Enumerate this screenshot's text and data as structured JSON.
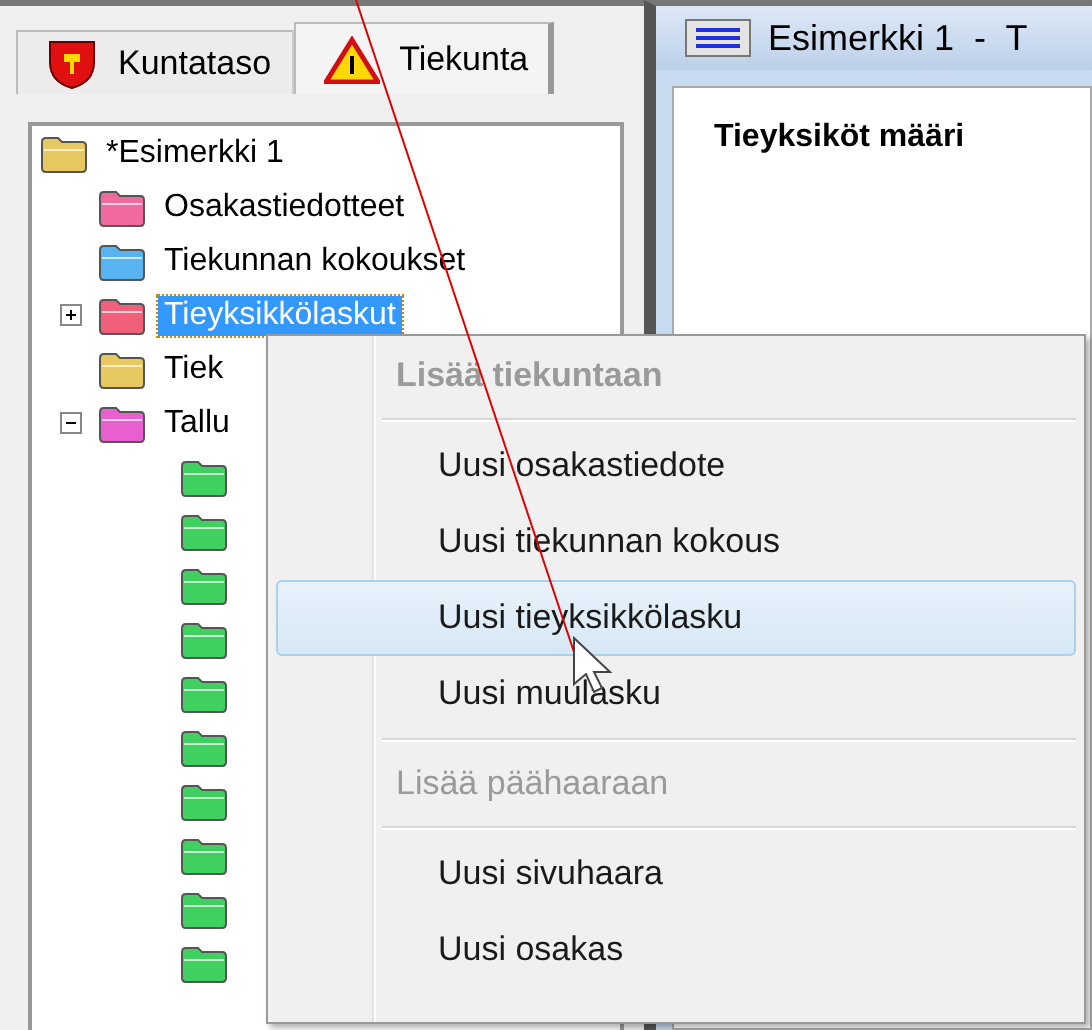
{
  "left_tabs": [
    {
      "label": "Kuntataso",
      "selected": false
    },
    {
      "label": "Tiekunta",
      "selected": true
    }
  ],
  "tree": {
    "label": "*Esimerkki 1",
    "color": "#e8c860",
    "children": [
      {
        "label": "Osakastiedotteet",
        "color": "#f06aa0",
        "selected": false
      },
      {
        "label": "Tiekunnan kokoukset",
        "color": "#58b4f0",
        "selected": false
      },
      {
        "label": "Tieyksikkölaskut",
        "color": "#f0607a",
        "expanded": false,
        "selected": true
      },
      {
        "label": "Tiek",
        "color": "#e8c860",
        "selected": false
      },
      {
        "label": "Tallu",
        "color": "#e860d0",
        "expanded": true,
        "selected": false,
        "children": [
          {
            "color": "#40d060"
          },
          {
            "color": "#40d060"
          },
          {
            "color": "#40d060"
          },
          {
            "color": "#40d060"
          },
          {
            "color": "#40d060"
          },
          {
            "color": "#40d060"
          },
          {
            "color": "#40d060"
          },
          {
            "color": "#40d060"
          },
          {
            "color": "#40d060"
          },
          {
            "color": "#40d060"
          }
        ]
      }
    ]
  },
  "document": {
    "title": "Esimerkki 1  -  T",
    "heading": "Tieyksiköt määri"
  },
  "context_menu": {
    "items": [
      {
        "kind": "header",
        "label": "Lisää tiekuntaan"
      },
      {
        "kind": "separator"
      },
      {
        "kind": "item",
        "label": "Uusi osakastiedote",
        "selected": false
      },
      {
        "kind": "item",
        "label": "Uusi tiekunnan kokous",
        "selected": false
      },
      {
        "kind": "item",
        "label": "Uusi tieyksikkölasku",
        "selected": true
      },
      {
        "kind": "item",
        "label": "Uusi muulasku",
        "selected": false
      },
      {
        "kind": "separator"
      },
      {
        "kind": "header",
        "label": "Lisää päähaaraan"
      },
      {
        "kind": "separator"
      },
      {
        "kind": "item",
        "label": "Uusi sivuhaara",
        "selected": false
      },
      {
        "kind": "item",
        "label": "Uusi osakas",
        "selected": false
      }
    ]
  }
}
